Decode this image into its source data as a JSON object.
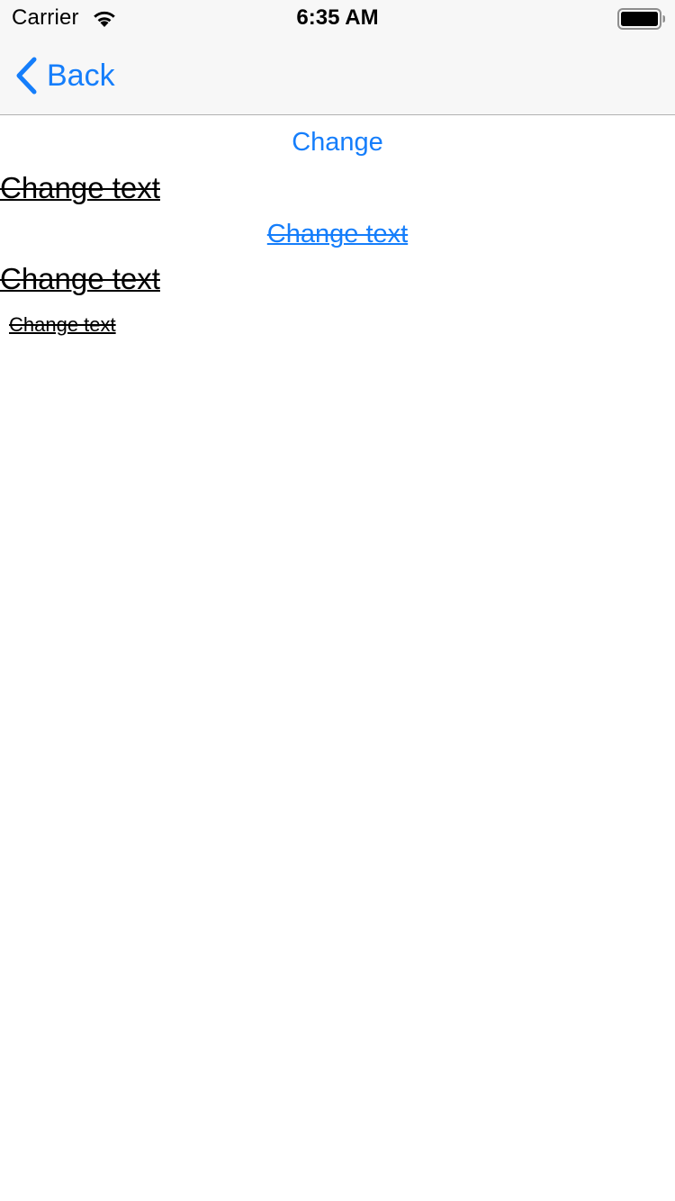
{
  "status_bar": {
    "carrier": "Carrier",
    "time": "6:35 AM",
    "icons": [
      "wifi-icon",
      "battery-icon"
    ]
  },
  "nav_bar": {
    "back_label": "Back",
    "back_icon": "chevron-left-icon"
  },
  "content": {
    "change_button_label": "Change",
    "labels": [
      "Change text",
      "Change text",
      "Change text",
      "Change text"
    ]
  },
  "colors": {
    "accent": "#157efb",
    "text": "#000000",
    "nav_background": "#f7f7f7",
    "separator": "#b2b2b2",
    "background": "#ffffff"
  }
}
